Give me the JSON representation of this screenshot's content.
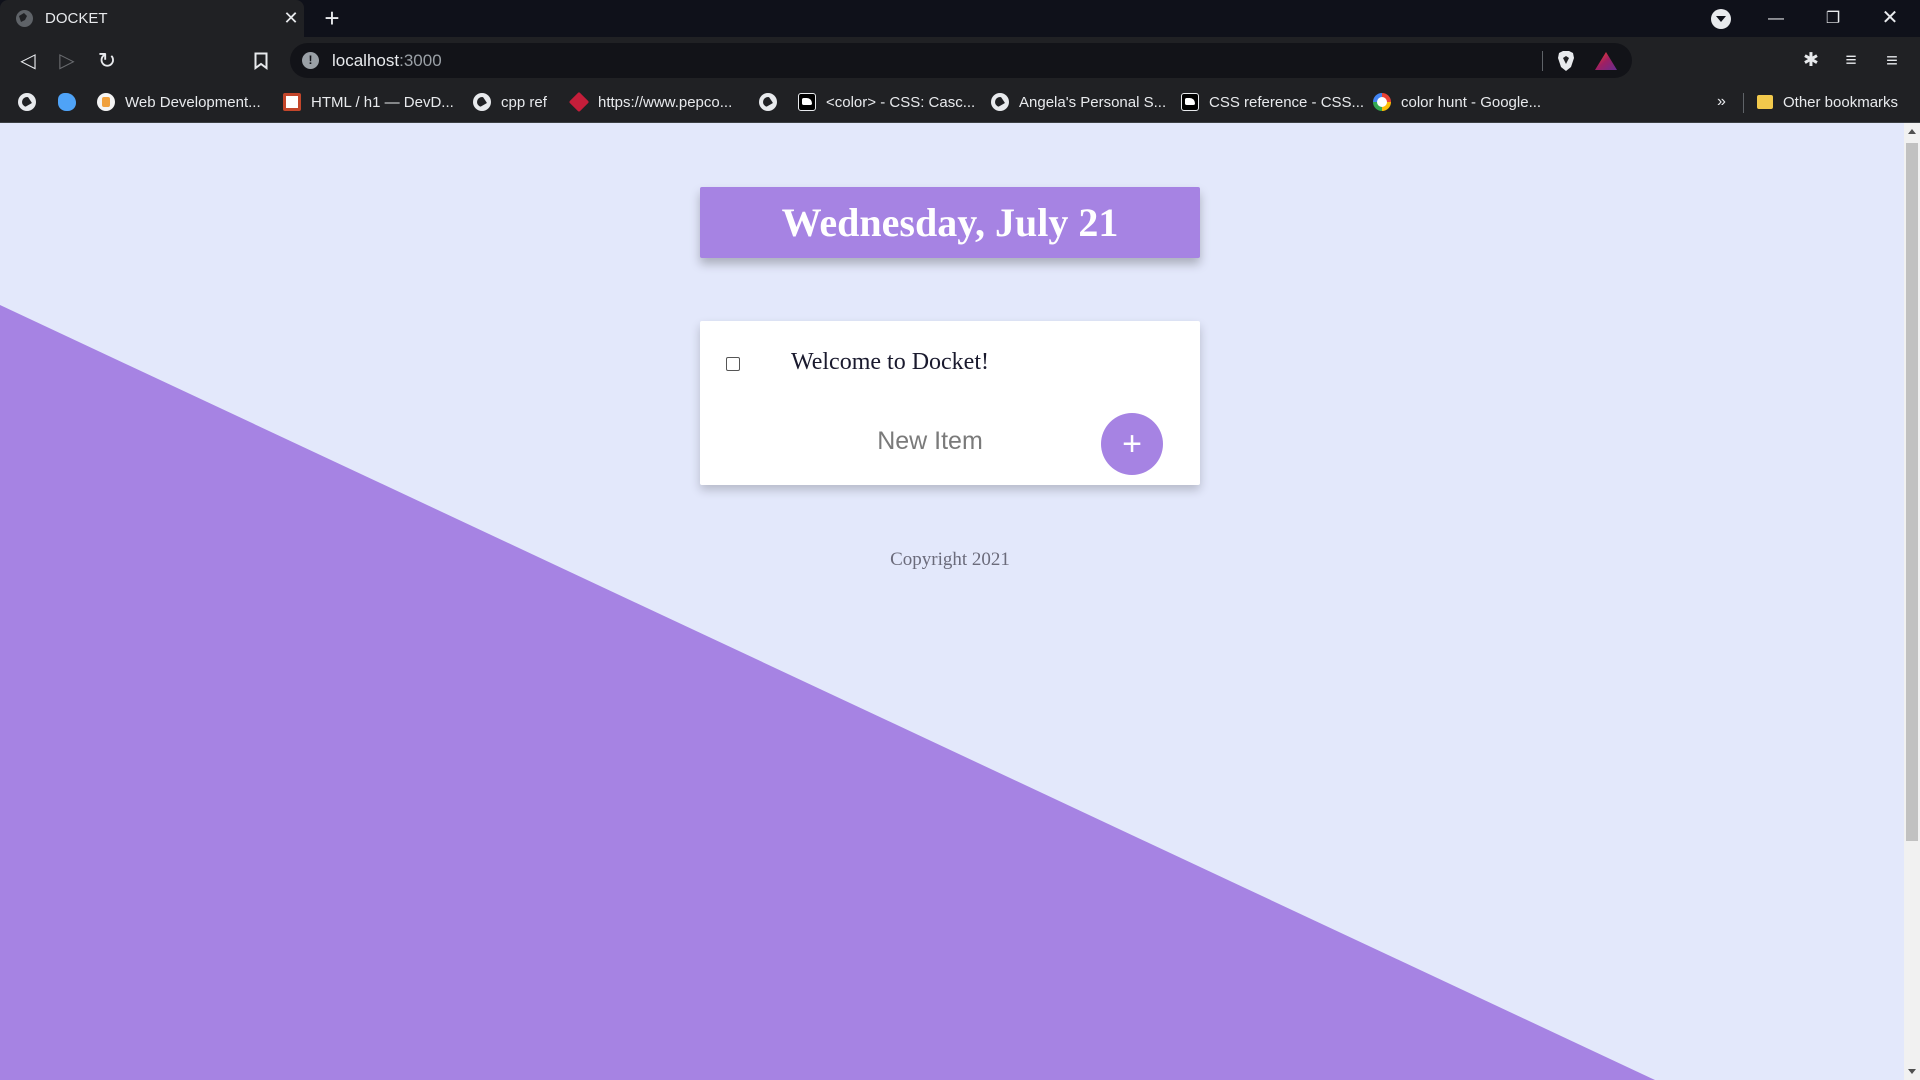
{
  "browser": {
    "tab_title": "DOCKET",
    "url_host": "localhost",
    "url_port": ":3000",
    "bookmarks": [
      {
        "label": "",
        "icon": "globe-icon"
      },
      {
        "label": "",
        "icon": "blue-bird-icon"
      },
      {
        "label": "Web Development...",
        "icon": "udemy-icon"
      },
      {
        "label": "HTML / h1 — DevD...",
        "icon": "devdocs-icon"
      },
      {
        "label": "cpp ref",
        "icon": "globe-icon"
      },
      {
        "label": "https://www.pepco...",
        "icon": "pepco-icon"
      },
      {
        "label": "",
        "icon": "globe-icon"
      },
      {
        "label": "<color> - CSS: Casc...",
        "icon": "mdn-icon"
      },
      {
        "label": "Angela's Personal S...",
        "icon": "globe-icon"
      },
      {
        "label": "CSS reference - CSS...",
        "icon": "mdn-icon"
      },
      {
        "label": "color hunt - Google...",
        "icon": "google-icon"
      }
    ],
    "bookmarks_overflow": "»",
    "other_bookmarks": "Other bookmarks"
  },
  "page": {
    "heading": "Wednesday, July 21",
    "items": [
      {
        "text": "Welcome to Docket!",
        "checked": false
      }
    ],
    "new_item_placeholder": "New Item",
    "add_button_label": "+",
    "footer": "Copyright 2021"
  },
  "colors": {
    "accent": "#a683e3",
    "page_background": "#e3e8fb",
    "card": "#ffffff"
  }
}
